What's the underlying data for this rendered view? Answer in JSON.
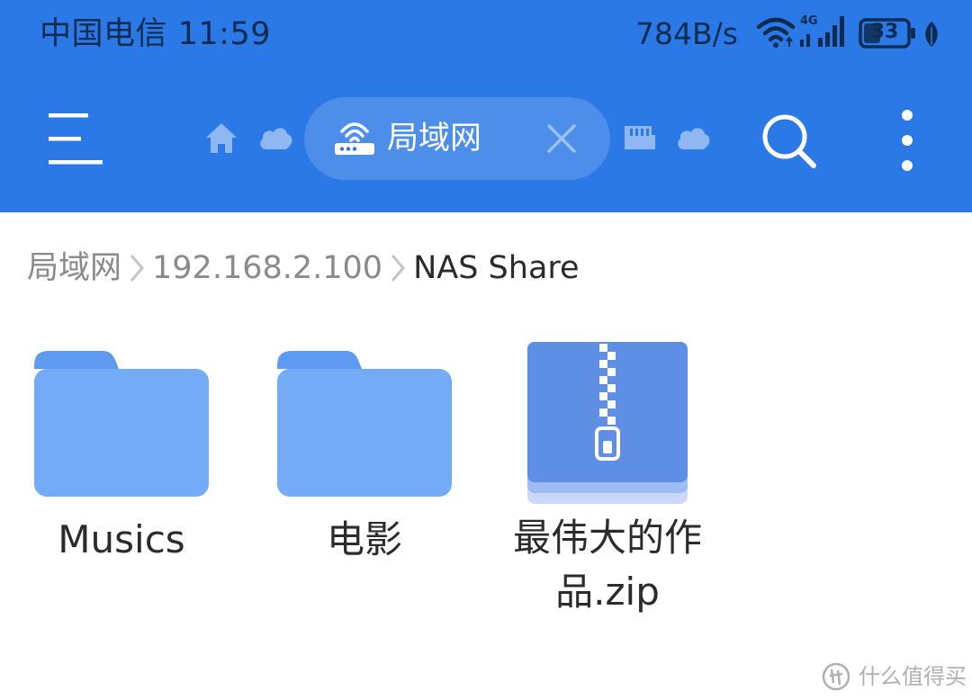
{
  "status_bar": {
    "carrier_time": "中国电信 11:59",
    "net_speed": "784B/s",
    "network_type": "4G",
    "battery_level": "33"
  },
  "toolbar": {
    "menu_icon": "hamburger-menu-icon",
    "tabs": [
      {
        "icon": "home-icon"
      },
      {
        "icon": "cloud-icon"
      },
      {
        "icon": "router-icon",
        "label": "局域网",
        "active": true
      },
      {
        "icon": "sd-card-icon"
      },
      {
        "icon": "cloud-icon"
      }
    ],
    "search_icon": "search-icon",
    "more_icon": "more-vertical-icon"
  },
  "breadcrumb": [
    "局域网",
    "192.168.2.100",
    "NAS Share"
  ],
  "files": [
    {
      "name": "Musics",
      "type": "folder"
    },
    {
      "name": "电影",
      "type": "folder"
    },
    {
      "name": "最伟大的作品.zip",
      "type": "zip"
    }
  ],
  "watermark": {
    "text": "什么值得买"
  },
  "colors": {
    "header_blue": "#2a79e6",
    "folder_blue": "#74abf7",
    "folder_tab_blue": "#5e9af0",
    "zip_blue": "#5f8fe4"
  }
}
